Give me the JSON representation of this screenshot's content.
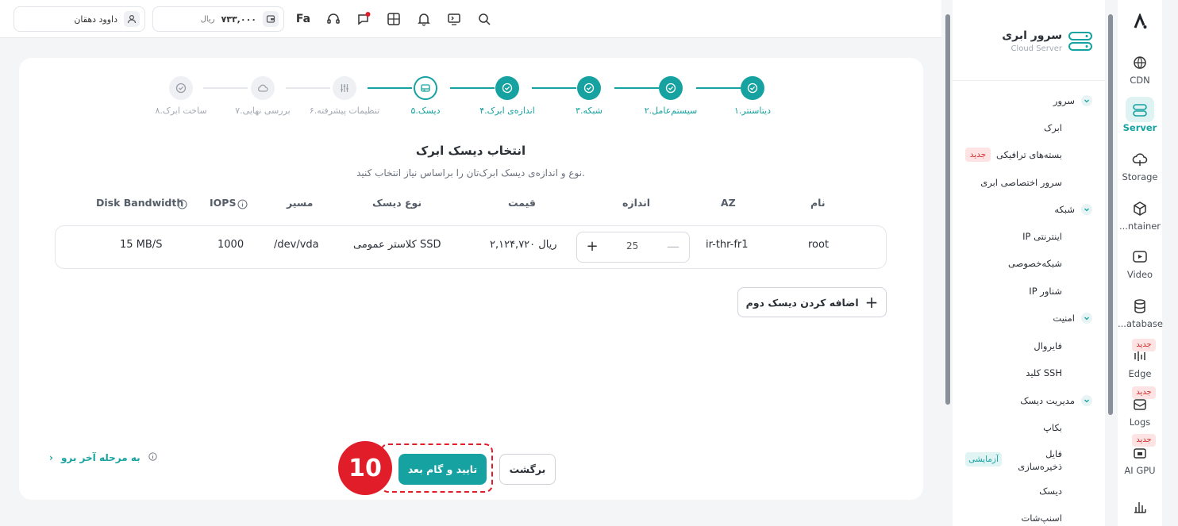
{
  "topbar": {
    "user_name": "داوود دهقان",
    "balance": "۷۳۳,۰۰۰",
    "currency": "ریال",
    "lang": "Fa"
  },
  "stepper": [
    {
      "label": "۱.دیتاسنتر",
      "state": "done"
    },
    {
      "label": "۲.سیستم‌عامل",
      "state": "done"
    },
    {
      "label": "۳.شبکه",
      "state": "done"
    },
    {
      "label": "۴.اندازه‌ی ابرک",
      "state": "done"
    },
    {
      "label": "۵.دیسک",
      "state": "current"
    },
    {
      "label": "۶.تنظیمات پیشرفته",
      "state": "todo"
    },
    {
      "label": "۷.بررسی نهایی",
      "state": "todo"
    },
    {
      "label": "۸.ساخت ابرک",
      "state": "todo"
    }
  ],
  "main": {
    "title": "انتخاب دیسک ابرک",
    "subtitle": "نوع و اندازه‌ی دیسک ابرک‌تان را براساس نیاز انتخاب کنید.",
    "columns": {
      "name": "نام",
      "az": "AZ",
      "size": "اندازه",
      "price": "قیمت",
      "disk_type": "نوع دیسک",
      "path": "مسیر",
      "iops": "IOPS",
      "bandwidth": "Disk Bandwidth"
    },
    "row": {
      "name": "root",
      "az": "ir-thr-fr1",
      "size": "25",
      "price": "۲,۱۲۴,۷۲۰ ریال",
      "disk_type": "کلاستر عمومی SSD",
      "path": "/dev/vda",
      "iops": "1000",
      "bandwidth": "15 MB/S"
    },
    "add_disk_label": "اضافه کردن دیسک دوم",
    "back_label": "برگشت",
    "confirm_label": "تایید و گام بعد",
    "skip_label": "به مرحله آخر برو",
    "annotation_number": "10"
  },
  "sidebar": {
    "product_title": "سرور ابری",
    "product_subtitle": "Cloud Server",
    "sections": [
      {
        "label": "سرور",
        "items": [
          {
            "label": "ابرک"
          },
          {
            "label": "بسته‌های ترافیکی",
            "badge": "جدید"
          },
          {
            "label": "سرور اختصاصی ابری"
          }
        ]
      },
      {
        "label": "شبکه",
        "items": [
          {
            "label": "IP اینترنتی"
          },
          {
            "label": "شبکه‌خصوصی"
          },
          {
            "label": "IP شناور"
          }
        ]
      },
      {
        "label": "امنیت",
        "items": [
          {
            "label": "فایروال"
          },
          {
            "label": "کلید SSH"
          }
        ]
      },
      {
        "label": "مدیریت دیسک",
        "items": [
          {
            "label": "بکاپ"
          },
          {
            "label": "فایل ذخیره‌سازی",
            "badge": "آزمایشی"
          },
          {
            "label": "دیسک"
          },
          {
            "label": "اسنپ‌شات"
          }
        ]
      }
    ]
  },
  "rail": [
    {
      "label": "CDN",
      "icon": "cdn-icon"
    },
    {
      "label": "Server",
      "icon": "server-icon",
      "active": true
    },
    {
      "label": "Storage",
      "icon": "cloud-storage-icon"
    },
    {
      "label": "...ntainer",
      "icon": "container-icon"
    },
    {
      "label": "Video",
      "icon": "video-icon"
    },
    {
      "label": "...atabase",
      "icon": "database-icon"
    },
    {
      "label": "Edge",
      "icon": "edge-icon",
      "badge": "جدید"
    },
    {
      "label": "Logs",
      "icon": "logs-icon",
      "badge": "جدید"
    },
    {
      "label": "AI GPU",
      "icon": "gpu-icon",
      "badge": "جدید"
    }
  ],
  "colors": {
    "accent": "#16a2a0",
    "annotation": "#e11d2a",
    "new_badge_bg": "#fde3e3",
    "new_badge_fg": "#d32f2f"
  }
}
